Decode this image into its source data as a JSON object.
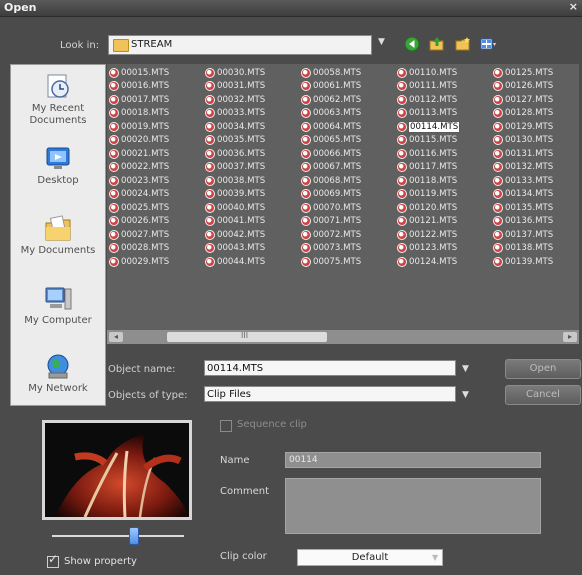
{
  "window": {
    "title": "Open",
    "close_glyph": "×"
  },
  "lookin": {
    "label": "Look in:",
    "value": "STREAM",
    "dropdown_glyph": "▼"
  },
  "toolbar": {
    "icons": [
      "back-icon",
      "up-folder-icon",
      "new-folder-icon",
      "view-menu-icon"
    ],
    "view_menu_arrow": "▾"
  },
  "places": [
    {
      "label": "My Recent Documents",
      "icon": "recent-documents-icon"
    },
    {
      "label": "Desktop",
      "icon": "desktop-icon"
    },
    {
      "label": "My Documents",
      "icon": "my-documents-icon"
    },
    {
      "label": "My Computer",
      "icon": "my-computer-icon"
    },
    {
      "label": "My Network",
      "icon": "my-network-icon"
    }
  ],
  "files": {
    "columns": [
      [
        "00015.MTS",
        "00016.MTS",
        "00017.MTS",
        "00018.MTS",
        "00019.MTS",
        "00020.MTS",
        "00021.MTS",
        "00022.MTS",
        "00023.MTS",
        "00024.MTS",
        "00025.MTS",
        "00026.MTS",
        "00027.MTS",
        "00028.MTS",
        "00029.MTS"
      ],
      [
        "00030.MTS",
        "00031.MTS",
        "00032.MTS",
        "00033.MTS",
        "00034.MTS",
        "00035.MTS",
        "00036.MTS",
        "00037.MTS",
        "00038.MTS",
        "00039.MTS",
        "00040.MTS",
        "00041.MTS",
        "00042.MTS",
        "00043.MTS",
        "00044.MTS"
      ],
      [
        "00058.MTS",
        "00061.MTS",
        "00062.MTS",
        "00063.MTS",
        "00064.MTS",
        "00065.MTS",
        "00066.MTS",
        "00067.MTS",
        "00068.MTS",
        "00069.MTS",
        "00070.MTS",
        "00071.MTS",
        "00072.MTS",
        "00073.MTS",
        "00075.MTS"
      ],
      [
        "00110.MTS",
        "00111.MTS",
        "00112.MTS",
        "00113.MTS",
        "00114.MTS",
        "00115.MTS",
        "00116.MTS",
        "00117.MTS",
        "00118.MTS",
        "00119.MTS",
        "00120.MTS",
        "00121.MTS",
        "00122.MTS",
        "00123.MTS",
        "00124.MTS"
      ],
      [
        "00125.MTS",
        "00126.MTS",
        "00127.MTS",
        "00128.MTS",
        "00129.MTS",
        "00130.MTS",
        "00131.MTS",
        "00132.MTS",
        "00133.MTS",
        "00134.MTS",
        "00135.MTS",
        "00136.MTS",
        "00137.MTS",
        "00138.MTS",
        "00139.MTS"
      ]
    ],
    "selected": "00114.MTS",
    "icon": "mts-file-icon"
  },
  "scrollbar": {
    "left_glyph": "◂",
    "right_glyph": "▸",
    "grip_glyph": "III"
  },
  "form": {
    "object_name_label": "Object name:",
    "object_name_value": "00114.MTS",
    "objects_type_label": "Objects of type:",
    "objects_type_value": "Clip Files",
    "dropdown_glyph": "▼",
    "open_button": "Open",
    "cancel_button": "Cancel"
  },
  "properties": {
    "sequence_clip_label": "Sequence clip",
    "name_label": "Name",
    "name_value": "00114",
    "comment_label": "Comment",
    "comment_value": "",
    "clip_color_label": "Clip color",
    "clip_color_value": "Default",
    "clip_color_arrow": "▼",
    "show_property_label": "Show property",
    "show_property_checked": true,
    "show_property_check_glyph": "✓"
  },
  "colors": {
    "window_bg": "#4b4b4b",
    "list_bg": "#606060",
    "selection_bg": "#ffffff",
    "accent_blue": "#4f8ee8"
  }
}
